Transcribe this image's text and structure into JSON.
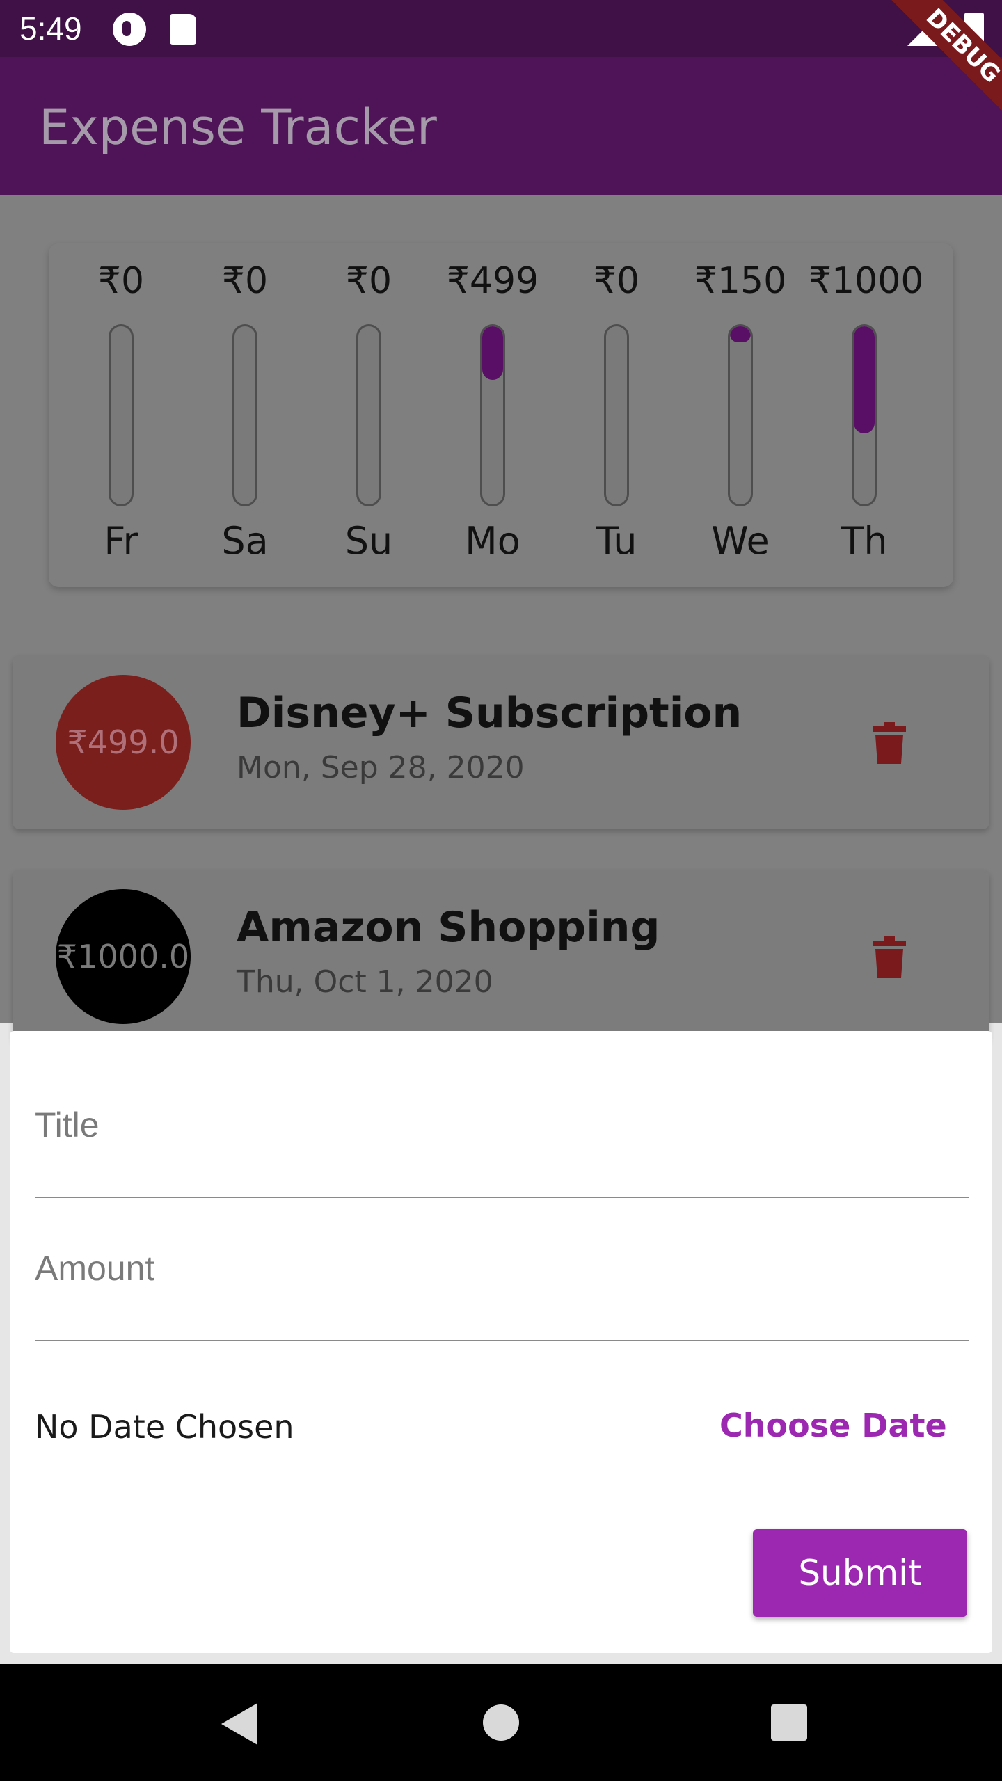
{
  "status_bar": {
    "time": "5:49"
  },
  "app_bar": {
    "title": "Expense Tracker"
  },
  "debug_banner": "DEBUG",
  "chart_data": {
    "type": "bar",
    "categories": [
      "Fr",
      "Sa",
      "Su",
      "Mo",
      "Tu",
      "We",
      "Th"
    ],
    "values": [
      0,
      0,
      0,
      499,
      0,
      150,
      1000
    ],
    "value_labels": [
      "₹0",
      "₹0",
      "₹0",
      "₹499",
      "₹0",
      "₹150",
      "₹1000"
    ],
    "fill_fraction": [
      0,
      0,
      0,
      0.3,
      0,
      0.09,
      0.6
    ],
    "colors": {
      "fill": "#5a0f67",
      "track": "#7a7a7a"
    }
  },
  "transactions": [
    {
      "amount": "₹499.0",
      "title": "Disney+ Subscription",
      "date": "Mon, Sep 28, 2020",
      "avatar_color": "#7a1f1c",
      "text_color": "#b0707a"
    },
    {
      "amount": "₹1000.0",
      "title": "Amazon Shopping",
      "date": "Thu, Oct 1, 2020",
      "avatar_color": "#000000",
      "text_color": "#7a7a7a"
    }
  ],
  "form": {
    "title_placeholder": "Title",
    "amount_placeholder": "Amount",
    "date_status": "No Date Chosen",
    "choose_date_label": "Choose Date",
    "submit_label": "Submit",
    "accent_color": "#9c27b0"
  }
}
